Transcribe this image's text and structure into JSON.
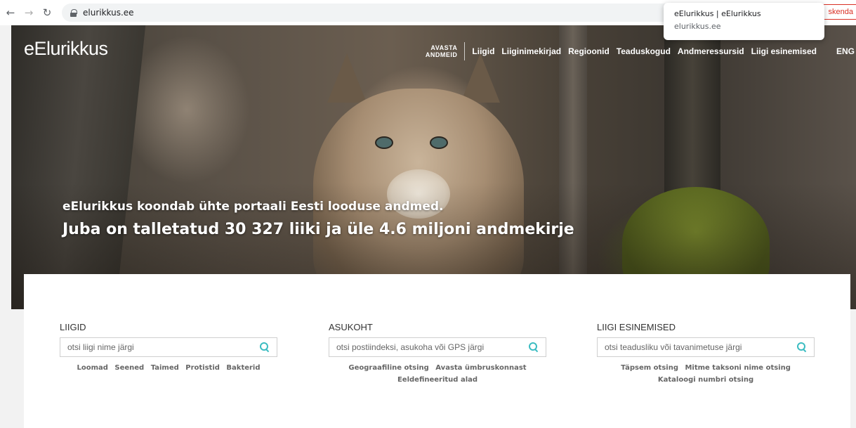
{
  "browser": {
    "url": "elurikkus.ee",
    "tooltip_title": "eElurikkus | eElurikkus",
    "tooltip_url": "elurikkus.ee",
    "partial_tab": "skenda"
  },
  "site": {
    "logo": "eElurikkus",
    "nav_avasta_line1": "AVASTA",
    "nav_avasta_line2": "ANDMEID",
    "nav": [
      "Liigid",
      "Liiginimekirjad",
      "Regioonid",
      "Teaduskogud",
      "Andmeressursid",
      "Liigi esinemised",
      "ENG"
    ]
  },
  "hero": {
    "line1": "eElurikkus koondab ühte portaali Eesti looduse andmed.",
    "line2": "Juba on talletatud 30 327 liiki ja üle 4.6 miljoni andmekirje"
  },
  "search": {
    "species": {
      "title": "LIIGID",
      "placeholder": "otsi liigi nime järgi",
      "links": [
        "Loomad",
        "Seened",
        "Taimed",
        "Protistid",
        "Bakterid"
      ]
    },
    "location": {
      "title": "ASUKOHT",
      "placeholder": "otsi postiindeksi, asukoha või GPS järgi",
      "links": [
        "Geograafiline otsing",
        "Avasta ümbruskonnast",
        "Eeldefineeritud alad"
      ]
    },
    "occurrences": {
      "title": "LIIGI ESINEMISED",
      "placeholder": "otsi teadusliku või tavanimetuse järgi",
      "links": [
        "Täpsem otsing",
        "Mitme taksoni nime otsing",
        "Kataloogi numbri otsing"
      ]
    }
  },
  "colors": {
    "accent": "#3bbcc1"
  }
}
